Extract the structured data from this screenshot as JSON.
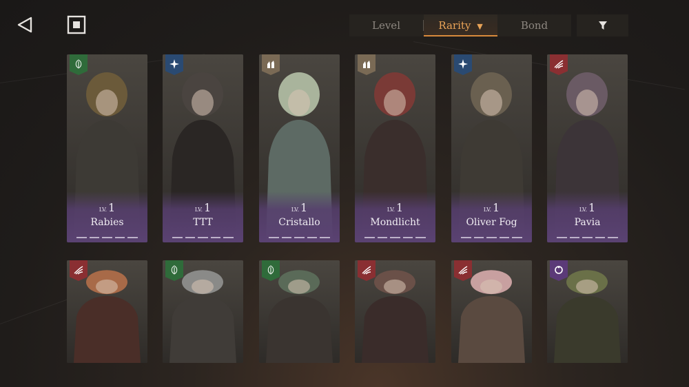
{
  "sort": {
    "options": [
      "Level",
      "Rarity",
      "Bond"
    ],
    "active": "Rarity",
    "active_arrow": "▼"
  },
  "icons": {
    "back": "back-triangle-icon",
    "home": "stop-square-icon",
    "filter": "funnel-icon"
  },
  "level_prefix": "LV.",
  "characters": [
    {
      "name": "Rabies",
      "level": "1",
      "afflatus": "plant",
      "badge_color": "#2f6b3a"
    },
    {
      "name": "TTT",
      "level": "1",
      "afflatus": "star",
      "badge_color": "#2a4a72"
    },
    {
      "name": "Cristallo",
      "level": "1",
      "afflatus": "mineral",
      "badge_color": "#7a6a55"
    },
    {
      "name": "Mondlicht",
      "level": "1",
      "afflatus": "mineral",
      "badge_color": "#7a6a55"
    },
    {
      "name": "Oliver Fog",
      "level": "1",
      "afflatus": "star",
      "badge_color": "#2a4a72"
    },
    {
      "name": "Pavia",
      "level": "1",
      "afflatus": "beast",
      "badge_color": "#8a2f32"
    },
    {
      "name": "",
      "level": "",
      "afflatus": "beast",
      "badge_color": "#8a2f32"
    },
    {
      "name": "",
      "level": "",
      "afflatus": "plant",
      "badge_color": "#2f6b3a"
    },
    {
      "name": "",
      "level": "",
      "afflatus": "plant",
      "badge_color": "#2f6b3a"
    },
    {
      "name": "",
      "level": "",
      "afflatus": "beast",
      "badge_color": "#8a2f32"
    },
    {
      "name": "",
      "level": "",
      "afflatus": "beast",
      "badge_color": "#8a2f32"
    },
    {
      "name": "",
      "level": "",
      "afflatus": "spirit",
      "badge_color": "#5b3a78"
    }
  ]
}
